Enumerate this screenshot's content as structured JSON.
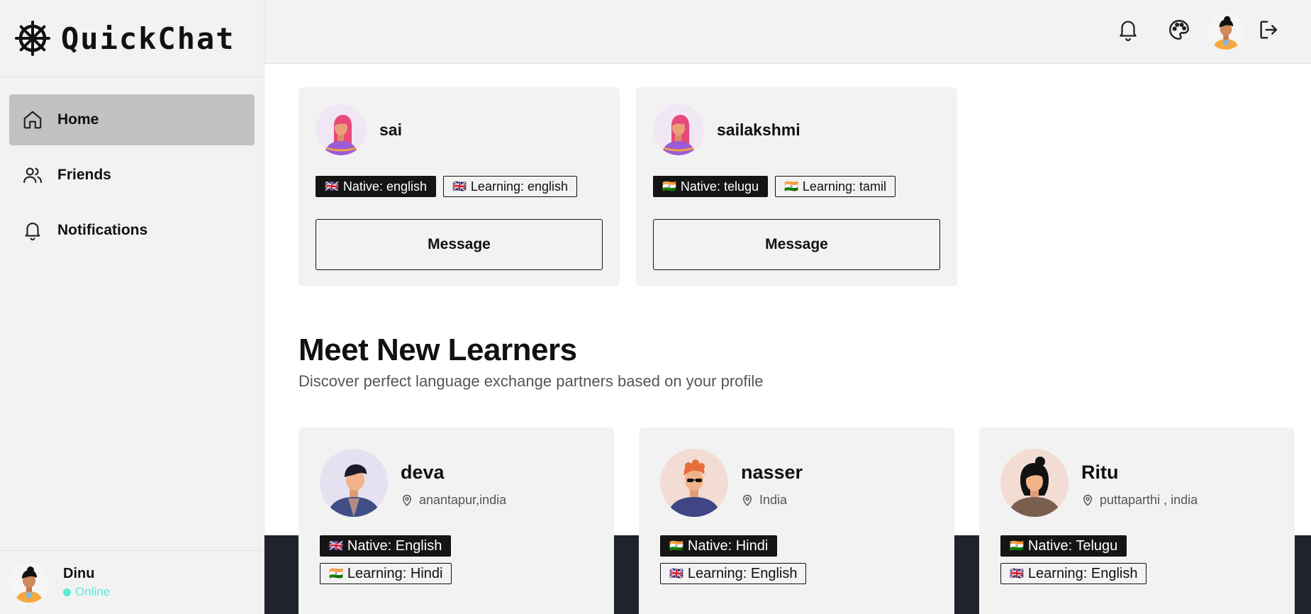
{
  "app": {
    "name": "QuickChat"
  },
  "sidebar": {
    "items": [
      {
        "label": "Home",
        "icon": "home-icon",
        "active": true
      },
      {
        "label": "Friends",
        "icon": "users-icon",
        "active": false
      },
      {
        "label": "Notifications",
        "icon": "bell-icon",
        "active": false
      }
    ],
    "user": {
      "name": "Dinu",
      "status": "Online"
    }
  },
  "topbar": {
    "icons": [
      "bell-icon",
      "palette-icon",
      "avatar",
      "logout-icon"
    ]
  },
  "friends": [
    {
      "name": "sai",
      "native": "Native: english",
      "native_flag": "🇬🇧",
      "learning": "Learning: english",
      "learning_flag": "🇬🇧",
      "button": "Message"
    },
    {
      "name": "sailakshmi",
      "native": "Native: telugu",
      "native_flag": "🇮🇳",
      "learning": "Learning: tamil",
      "learning_flag": "🇮🇳",
      "button": "Message"
    }
  ],
  "learners_section": {
    "title": "Meet New Learners",
    "subtitle": "Discover perfect language exchange partners based on your profile"
  },
  "learners": [
    {
      "name": "deva",
      "location": "anantapur,india",
      "native": "Native: English",
      "native_flag": "🇬🇧",
      "learning": "Learning: Hindi",
      "learning_flag": "🇮🇳"
    },
    {
      "name": "nasser",
      "location": "India",
      "native": "Native: Hindi",
      "native_flag": "🇮🇳",
      "learning": "Learning: English",
      "learning_flag": "🇬🇧"
    },
    {
      "name": "Ritu",
      "location": "puttaparthi , india",
      "native": "Native: Telugu",
      "native_flag": "🇮🇳",
      "learning": "Learning: English",
      "learning_flag": "🇬🇧"
    }
  ],
  "colors": {
    "sidebar_bg": "#f2f2f2",
    "active_nav": "#c2c2c2",
    "online": "#5eead4",
    "dark_band": "#1f242b",
    "tag_dark": "#151515"
  }
}
